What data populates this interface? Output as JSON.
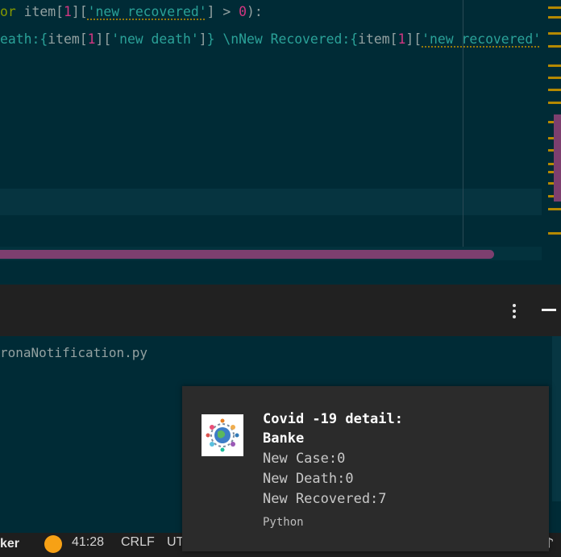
{
  "editor": {
    "line1": {
      "kw": "or",
      "var": "item",
      "idx": "1",
      "key": "'new recovered'",
      "op": " > ",
      "zero": "0",
      "tail": "):"
    },
    "line2": {
      "lead": "eath:{",
      "var1": "item",
      "idx1": "1",
      "key1": "'new death'",
      "mid": "} \\nNew Recovered:{",
      "var2": "item",
      "idx2": "1",
      "key2": "'new recovered'",
      "tail": "]}"
    }
  },
  "panel": {
    "more_icon": "more-vertical-icon",
    "minimize_icon": "minimize-icon"
  },
  "terminal": {
    "line1": "ronaNotification.py"
  },
  "statusbar": {
    "label": "ker",
    "cursor_position": "41:28",
    "line_ending": "CRLF",
    "encoding": "UT"
  },
  "toast": {
    "title": "Covid -19 detail:",
    "subtitle": "Banke",
    "lines": [
      "New Case:0",
      "New Death:0",
      "New Recovered:7"
    ],
    "source": "Python"
  },
  "colors": {
    "editor_bg": "#002b36",
    "string": "#2aa198",
    "number": "#d33682",
    "keyword": "#859900",
    "scroll_thumb": "#7d3f6f",
    "overview_mark": "#b58900",
    "panel_header": "#212121",
    "toast_bg": "#2b2b2b",
    "status_dot": "#f7a115"
  }
}
